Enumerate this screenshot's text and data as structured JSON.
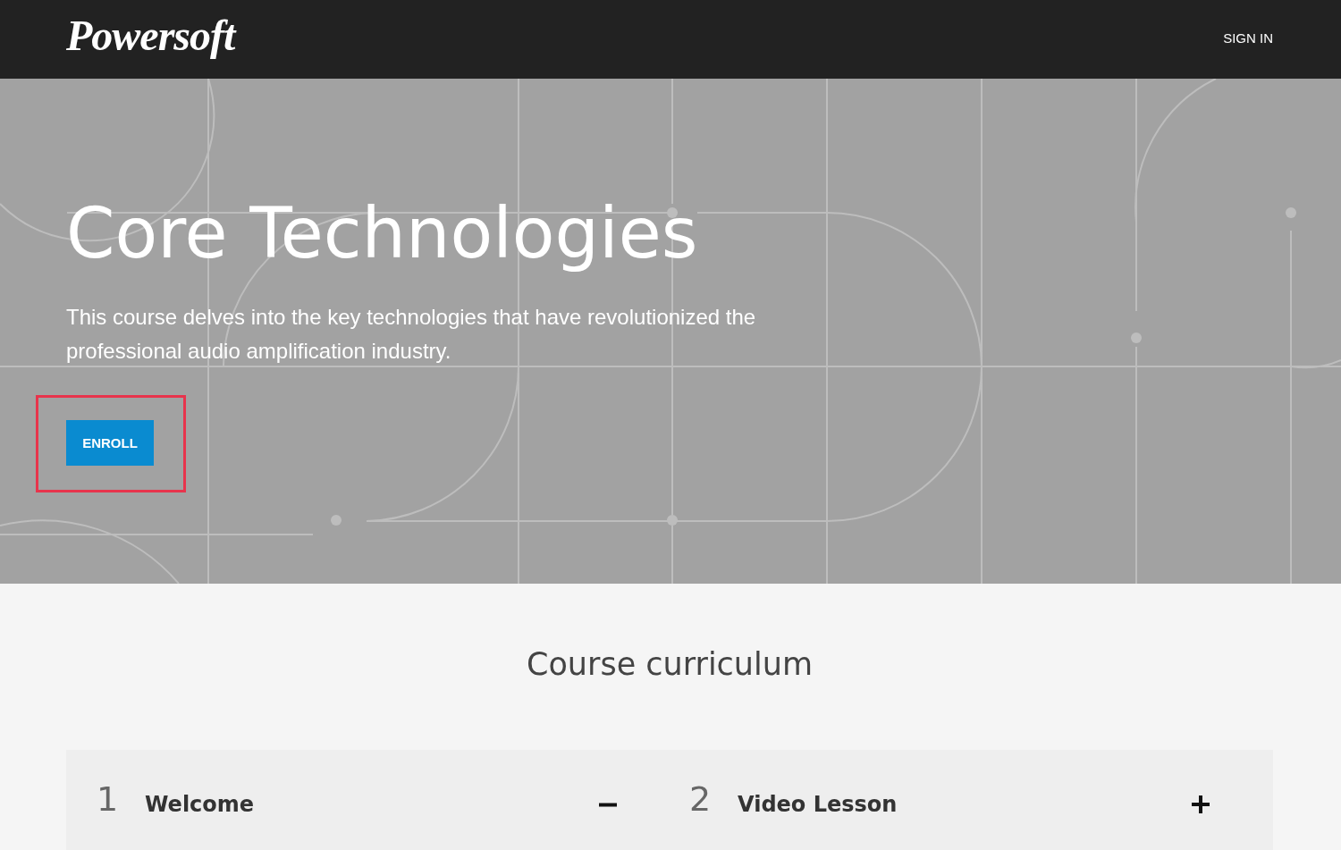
{
  "header": {
    "logo": "Powersoft",
    "sign_in": "SIGN IN"
  },
  "hero": {
    "title": "Core Technologies",
    "description": "This course delves into the key technologies that have revolutionized the professional audio amplification industry.",
    "enroll": {
      "label": "ENROLL",
      "highlighted": true
    }
  },
  "curriculum": {
    "title": "Course curriculum",
    "sections": [
      {
        "number": "1",
        "title": "Welcome",
        "expanded": true
      },
      {
        "number": "2",
        "title": "Video Lesson",
        "expanded": false
      }
    ]
  }
}
